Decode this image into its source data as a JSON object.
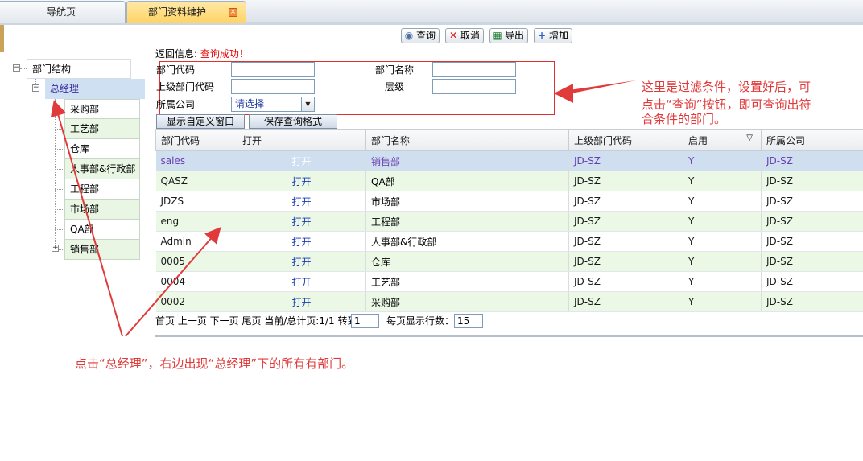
{
  "tabs": {
    "nav": "导航页",
    "active": "部门资料维护",
    "close_icon": "close-icon"
  },
  "toolbar": {
    "query": "查询",
    "cancel": "取消",
    "export": "导出",
    "add": "增加"
  },
  "return_info": {
    "label": "返回信息:",
    "message": "查询成功！"
  },
  "filter": {
    "dept_code_label": "部门代码",
    "dept_name_label": "部门名称",
    "parent_code_label": "上级部门代码",
    "level_label": "层级",
    "company_label": "所属公司",
    "company_select": "请选择",
    "show_custom_btn": "显示自定义窗口",
    "save_format_btn": "保存查询格式"
  },
  "tree": {
    "root": "部门结构",
    "general_manager": "总经理",
    "children": [
      "采购部",
      "工艺部",
      "仓库",
      "人事部&行政部",
      "工程部",
      "市场部",
      "QA部",
      "销售部"
    ]
  },
  "grid": {
    "columns": [
      "部门代码",
      "打开",
      "部门名称",
      "上级部门代码",
      "启用",
      "所属公司"
    ],
    "rows": [
      {
        "code": "sales",
        "open": "打开",
        "name": "销售部",
        "parent": "JD-SZ",
        "enabled": "Y",
        "company": "JD-SZ"
      },
      {
        "code": "QASZ",
        "open": "打开",
        "name": "QA部",
        "parent": "JD-SZ",
        "enabled": "Y",
        "company": "JD-SZ"
      },
      {
        "code": "JDZS",
        "open": "打开",
        "name": "市场部",
        "parent": "JD-SZ",
        "enabled": "Y",
        "company": "JD-SZ"
      },
      {
        "code": "eng",
        "open": "打开",
        "name": "工程部",
        "parent": "JD-SZ",
        "enabled": "Y",
        "company": "JD-SZ"
      },
      {
        "code": "Admin",
        "open": "打开",
        "name": "人事部&行政部",
        "parent": "JD-SZ",
        "enabled": "Y",
        "company": "JD-SZ"
      },
      {
        "code": "0005",
        "open": "打开",
        "name": "仓库",
        "parent": "JD-SZ",
        "enabled": "Y",
        "company": "JD-SZ"
      },
      {
        "code": "0004",
        "open": "打开",
        "name": "工艺部",
        "parent": "JD-SZ",
        "enabled": "Y",
        "company": "JD-SZ"
      },
      {
        "code": "0002",
        "open": "打开",
        "name": "采购部",
        "parent": "JD-SZ",
        "enabled": "Y",
        "company": "JD-SZ"
      }
    ]
  },
  "pager": {
    "text": "首页 上一页 下一页 尾页 当前/总计页:1/1 转到",
    "goto_value": "1",
    "rows_label": "每页显示行数：",
    "rows_value": "15"
  },
  "annotations": {
    "filter_note": [
      "这里是过滤条件，设置好后，可",
      "点击“查询”按钮，即可查询出符",
      "合条件的部门。"
    ],
    "tree_note": "点击“总经理”，右边出现“总经理”下的所有有部门。"
  },
  "colors": {
    "annotation": "#e03a3a",
    "selected_row": "#cfdff0",
    "alt_row": "#ebf8e6"
  }
}
